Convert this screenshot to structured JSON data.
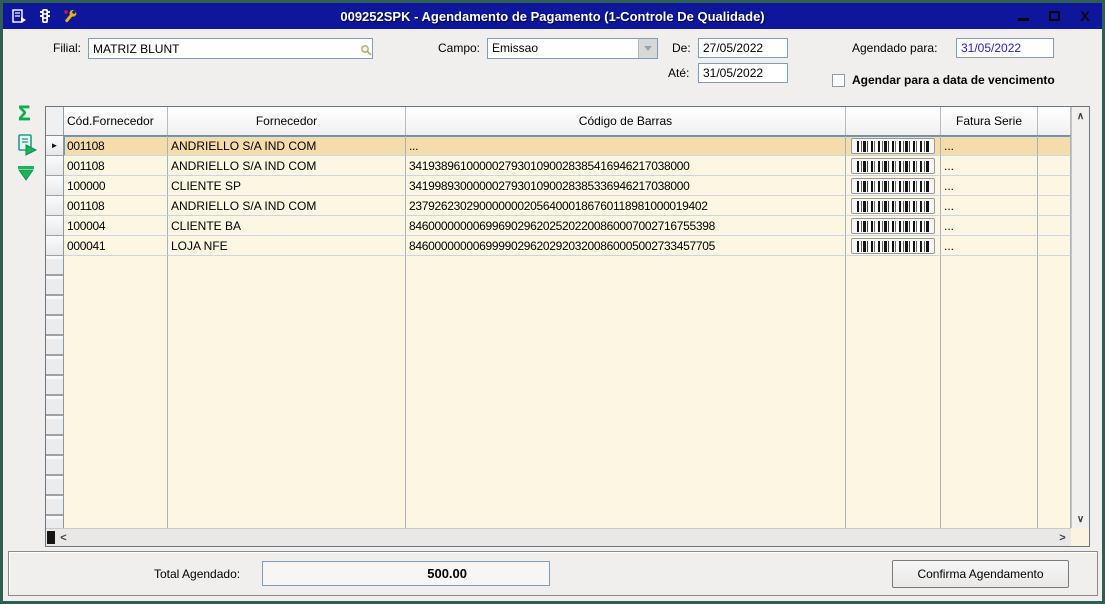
{
  "window": {
    "title": "009252SPK - Agendamento de Pagamento (1-Controle De Qualidade)",
    "controls": {
      "close_glyph": "X"
    }
  },
  "filters": {
    "filial_label": "Filial:",
    "filial_value": "MATRIZ BLUNT",
    "campo_label": "Campo:",
    "campo_value": "Emissao",
    "de_label": "De:",
    "de_value": "27/05/2022",
    "ate_label": "Até:",
    "ate_value": "31/05/2022",
    "agendado_label": "Agendado para:",
    "agendado_value": "31/05/2022",
    "vencimento_checkbox_label": "Agendar para a data de vencimento",
    "vencimento_checkbox_checked": false
  },
  "grid": {
    "columns": [
      "Cód.Fornecedor",
      "Fornecedor",
      "Código de Barras",
      "Fatura Serie"
    ],
    "selected_row_index": 0,
    "rows": [
      {
        "cod": "001108",
        "fornecedor": "ANDRIELLO S/A IND COM",
        "barras": "...",
        "fatura": "...",
        "selected": true
      },
      {
        "cod": "001108",
        "fornecedor": "ANDRIELLO S/A IND COM",
        "barras": "34193896100000279301090028385416946217038000",
        "fatura": "...",
        "selected": false
      },
      {
        "cod": "100000",
        "fornecedor": "CLIENTE SP",
        "barras": "34199893000000279301090028385336946217038000",
        "fatura": "...",
        "selected": false
      },
      {
        "cod": "001108",
        "fornecedor": "ANDRIELLO S/A IND COM",
        "barras": "23792623029000000020564000186760118981000019402",
        "fatura": "...",
        "selected": false
      },
      {
        "cod": "100004",
        "fornecedor": "CLIENTE BA",
        "barras": "846000000006996902962025202200860007002716755398",
        "fatura": "...",
        "selected": false
      },
      {
        "cod": "000041",
        "fornecedor": "LOJA NFE",
        "barras": "846000000006999902962029203200860005002733457705",
        "fatura": "...",
        "selected": false
      }
    ]
  },
  "footer": {
    "total_label": "Total Agendado:",
    "total_value": "500.00",
    "confirm_button_label": "Confirma Agendamento"
  },
  "icons": {
    "sum": "Σ",
    "row_marker": "►",
    "scroll_up": "∧",
    "scroll_down": "∨",
    "scroll_left": "<",
    "scroll_right": ">"
  },
  "colors": {
    "titlebar": "#0e169b",
    "window_border": "#2d5f53",
    "row_bg": "#fdf6e2",
    "row_selected_bg": "#f7dcab",
    "selection_border": "#5f9bcc",
    "accent_green": "#0ca94e",
    "date_text_blue": "#2121cc"
  }
}
